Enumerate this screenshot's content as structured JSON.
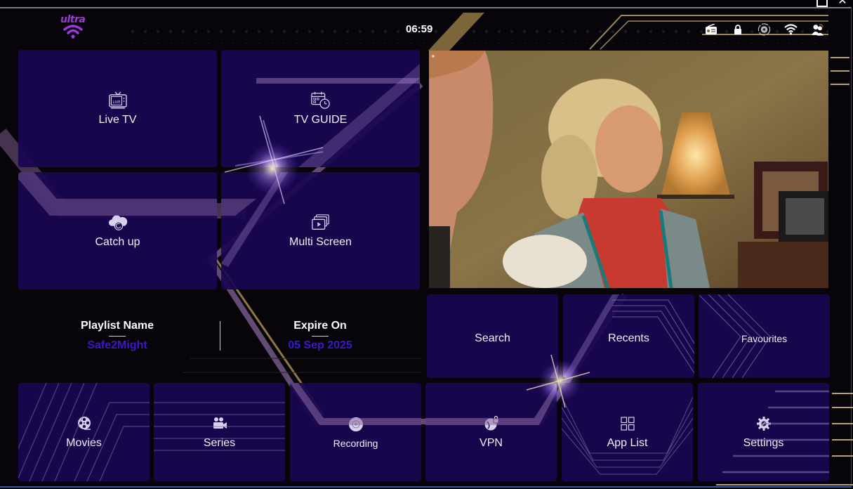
{
  "window": {
    "controls": [
      {
        "name": "maximize",
        "glyph": ""
      },
      {
        "name": "close",
        "glyph": "✕"
      }
    ]
  },
  "header": {
    "logo_text": "ultra",
    "time": "06:59",
    "status_icons": [
      "radio-icon",
      "lock-icon",
      "settings-sync-icon",
      "wifi-icon",
      "user-switch-icon"
    ]
  },
  "main_tiles": [
    {
      "id": "live-tv",
      "label": "Live TV",
      "icon": "live-tv-icon"
    },
    {
      "id": "tv-guide",
      "label": "TV GUIDE",
      "icon": "calendar-clock-icon"
    },
    {
      "id": "catch-up",
      "label": "Catch up",
      "icon": "cloud-replay-icon"
    },
    {
      "id": "multi-screen",
      "label": "Multi Screen",
      "icon": "multi-screen-icon"
    }
  ],
  "video_player": {
    "state": "playing"
  },
  "account_info": {
    "playlist_title": "Playlist Name",
    "playlist_value": "Safe2Might",
    "expire_title": "Expire On",
    "expire_value": "05 Sep 2025",
    "value_color": "#3a1ac8"
  },
  "quick_tiles": [
    {
      "id": "search",
      "label": "Search"
    },
    {
      "id": "recents",
      "label": "Recents"
    },
    {
      "id": "favourites",
      "label": "Favourites"
    }
  ],
  "bottom_tiles": [
    {
      "id": "movies",
      "label": "Movies",
      "icon": "film-reel-icon"
    },
    {
      "id": "series",
      "label": "Series",
      "icon": "video-camera-icon"
    },
    {
      "id": "recording",
      "label": "Recording",
      "icon": "disc-icon"
    },
    {
      "id": "vpn",
      "label": "VPN",
      "icon": "vpn-lock-icon"
    },
    {
      "id": "app-list",
      "label": "App List",
      "icon": "grid-icon"
    },
    {
      "id": "settings",
      "label": "Settings",
      "icon": "gear-wrench-icon"
    }
  ],
  "theme": {
    "tile_color": "#1a0652",
    "accent_purple": "#9a3ad8",
    "gold": "#b8a070"
  }
}
